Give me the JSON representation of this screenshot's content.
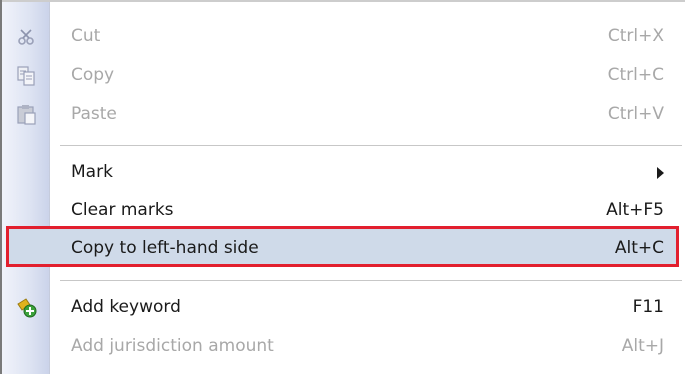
{
  "menu": {
    "items": [
      {
        "label": "Cut",
        "shortcut": "Ctrl+X",
        "icon": "scissors-icon",
        "enabled": false
      },
      {
        "label": "Copy",
        "shortcut": "Ctrl+C",
        "icon": "copy-icon",
        "enabled": false
      },
      {
        "label": "Paste",
        "shortcut": "Ctrl+V",
        "icon": "paste-icon",
        "enabled": false
      },
      {
        "label": "Mark",
        "shortcut": "",
        "icon": "submenu-arrow-icon",
        "enabled": true
      },
      {
        "label": "Clear marks",
        "shortcut": "Alt+F5",
        "icon": "",
        "enabled": true
      },
      {
        "label": "Copy to left-hand side",
        "shortcut": "Alt+C",
        "icon": "",
        "enabled": true,
        "highlighted": true
      },
      {
        "label": "Add keyword",
        "shortcut": "F11",
        "icon": "add-keyword-icon",
        "enabled": true
      },
      {
        "label": "Add jurisdiction amount",
        "shortcut": "Alt+J",
        "icon": "",
        "enabled": false
      }
    ]
  },
  "colors": {
    "highlight_bg": "#cfdae9",
    "highlight_border": "#e21f2e",
    "disabled_text": "#a8a8a8",
    "gutter": "#dde3f2"
  }
}
